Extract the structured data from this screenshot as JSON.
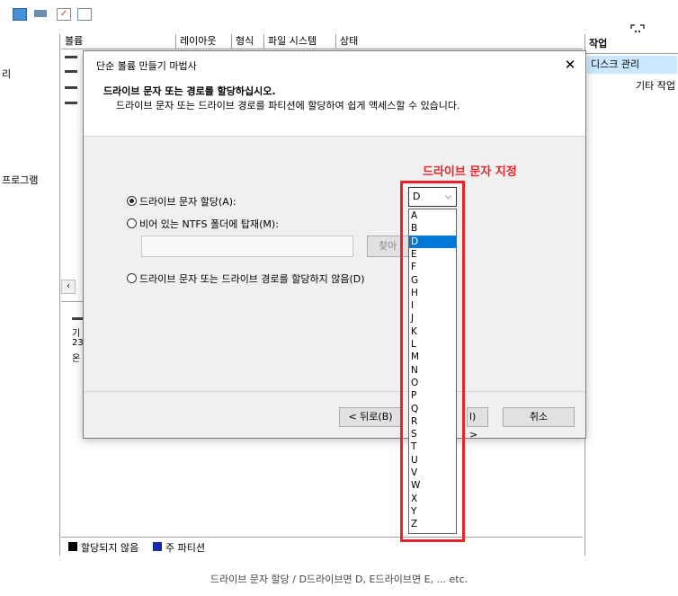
{
  "window": {
    "left_panel": {
      "items": [
        "리",
        "프로그램"
      ]
    },
    "columns": [
      "볼륨",
      "레이아웃",
      "형식",
      "파일 시스템",
      "상태"
    ],
    "disk_label": {
      "line1": "기",
      "line2": "23",
      "line3": "온"
    },
    "legend": {
      "unallocated": "할당되지 않음",
      "primary": "주 파티션"
    },
    "actions": {
      "title": "작업",
      "selected": "디스크 관리",
      "other": "기타 작업"
    }
  },
  "dialog": {
    "title": "단순 볼륨 만들기 마법사",
    "close": "✕",
    "heading": "드라이브 문자 또는 경로를 할당하십시오.",
    "subheading": "드라이브 문자 또는 드라이브 경로를 파티션에 할당하여 쉽게 액세스할 수 있습니다.",
    "options": {
      "assign": "드라이브 문자 할당(A):",
      "mount": "비어 있는 NTFS 폴더에 탑재(M):",
      "none": "드라이브 문자 또는 드라이브 경로를 할당하지 않음(D)"
    },
    "browse": "찾아",
    "back": "< 뒤로(B)",
    "next_partial": "l) >",
    "cancel": "취소",
    "drive_select": {
      "value": "D",
      "options": [
        "A",
        "B",
        "D",
        "E",
        "F",
        "G",
        "H",
        "I",
        "J",
        "K",
        "L",
        "M",
        "N",
        "O",
        "P",
        "Q",
        "R",
        "S",
        "T",
        "U",
        "V",
        "W",
        "X",
        "Y",
        "Z"
      ],
      "selected": "D"
    }
  },
  "annotation": {
    "label": "드라이브 문자 지정",
    "color": "#e8232a"
  },
  "caption": "드라이브 문자 할당 / D드라이브면 D, E드라이브면 E, ... etc."
}
